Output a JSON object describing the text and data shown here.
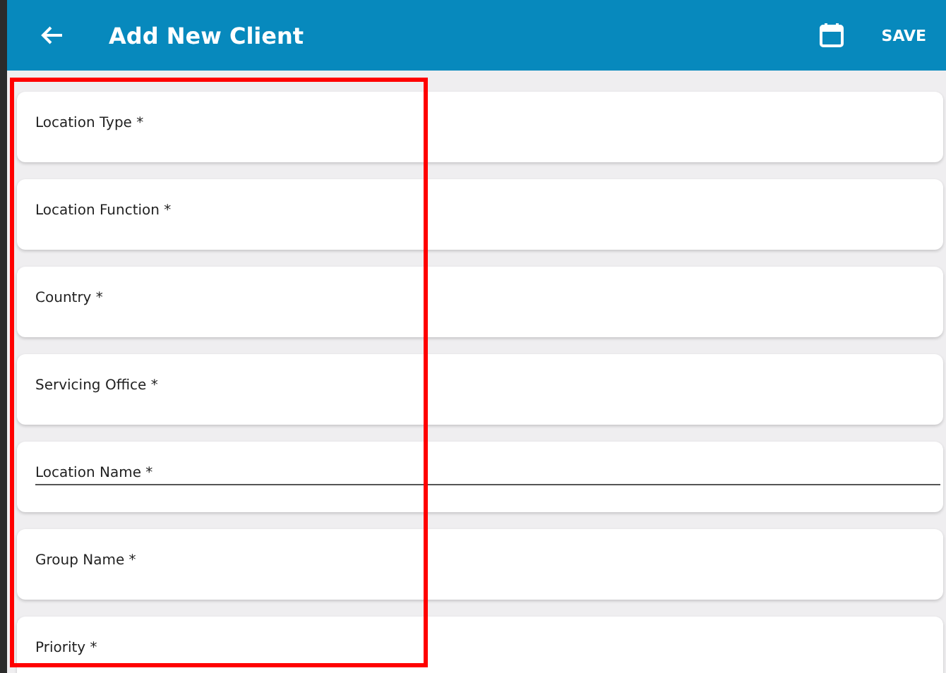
{
  "app_bar": {
    "title": "Add New Client",
    "action": "SAVE"
  },
  "fields": [
    {
      "label": "Location Type *",
      "focused": false
    },
    {
      "label": "Location Function *",
      "focused": false
    },
    {
      "label": "Country *",
      "focused": false
    },
    {
      "label": "Servicing Office *",
      "focused": false
    },
    {
      "label": "Location Name *",
      "focused": true
    },
    {
      "label": "Group Name *",
      "focused": false
    },
    {
      "label": "Priority *",
      "focused": false
    }
  ],
  "highlight": {
    "visible": true
  }
}
